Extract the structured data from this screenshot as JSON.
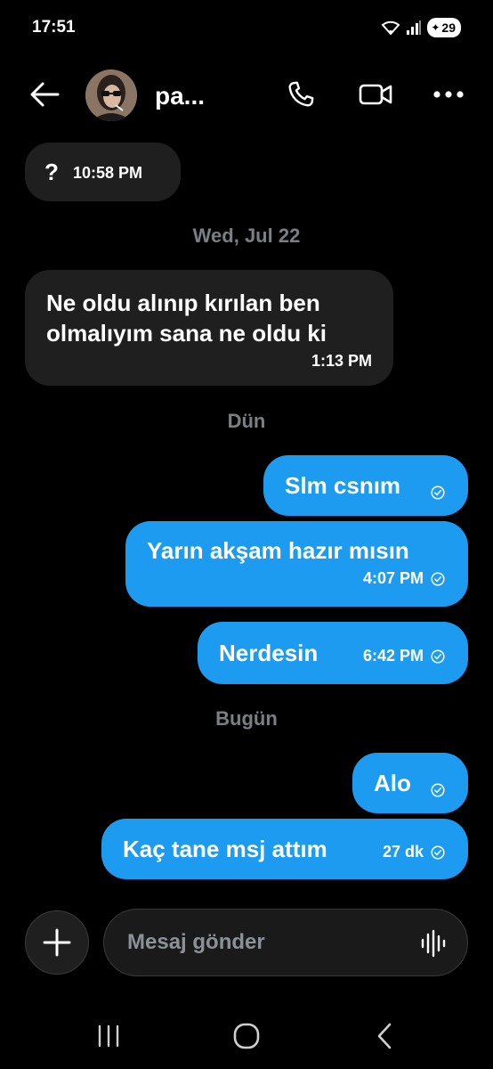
{
  "status_bar": {
    "time": "17:51",
    "battery": "29"
  },
  "header": {
    "contact_name": "pa..."
  },
  "messages": [
    {
      "direction": "in",
      "text": "?",
      "time": "10:58 PM"
    },
    {
      "direction": "in",
      "text": "Ne oldu alınıp kırılan  ben olmalıyım sana ne oldu ki",
      "line1": "Ne oldu alınıp kırılan  ben",
      "line2": "olmalıyım sana ne oldu ki",
      "time": "1:13 PM"
    },
    {
      "direction": "out",
      "text": "Slm csnım",
      "time": ""
    },
    {
      "direction": "out",
      "text": "Yarın akşam hazır mısın",
      "time": "4:07 PM"
    },
    {
      "direction": "out",
      "text": "Nerdesin",
      "time": "6:42 PM"
    },
    {
      "direction": "out",
      "text": "Alo",
      "time": ""
    },
    {
      "direction": "out",
      "text": "Kaç tane msj attım",
      "time": "27 dk"
    }
  ],
  "date_separators": [
    "Wed, Jul 22",
    "Dün",
    "Bugün"
  ],
  "composer": {
    "placeholder": "Mesaj gönder"
  },
  "colors": {
    "accent": "#1d9bf0",
    "incoming": "#1f1f1f",
    "background": "#000000"
  },
  "icons": [
    "back-arrow-icon",
    "phone-icon",
    "video-icon",
    "more-icon",
    "plus-icon",
    "voice-wave-icon",
    "check-icon",
    "recent-apps-icon",
    "home-icon",
    "back-nav-icon"
  ]
}
